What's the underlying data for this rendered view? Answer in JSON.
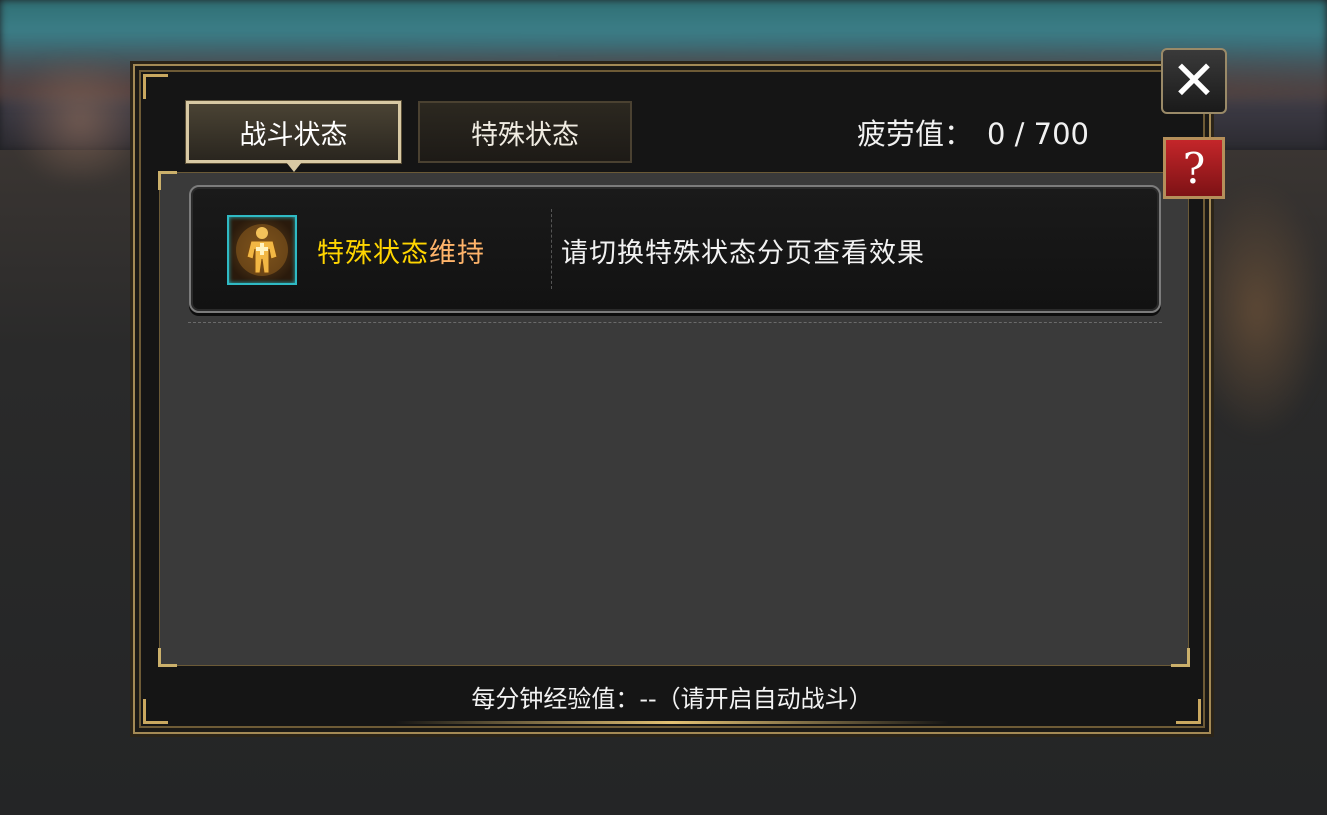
{
  "tabs": [
    {
      "label": "战斗状态",
      "active": true
    },
    {
      "label": "特殊状态",
      "active": false
    }
  ],
  "fatigue": {
    "label": "疲劳值：",
    "value": "0 / 700"
  },
  "status_list": [
    {
      "icon": "buff-body-icon",
      "name_part1": "特殊状态",
      "name_part2": "维持",
      "description": "请切换特殊状态分页查看效果"
    }
  ],
  "footer": {
    "text": "每分钟经验值：--（请开启自动战斗）"
  },
  "buttons": {
    "close": "✕",
    "help": "?"
  },
  "colors": {
    "highlight_yellow": "#ffd500",
    "highlight_orange": "#ffb46a",
    "frame_gold": "#a48a55",
    "icon_border": "#2fbac4"
  }
}
